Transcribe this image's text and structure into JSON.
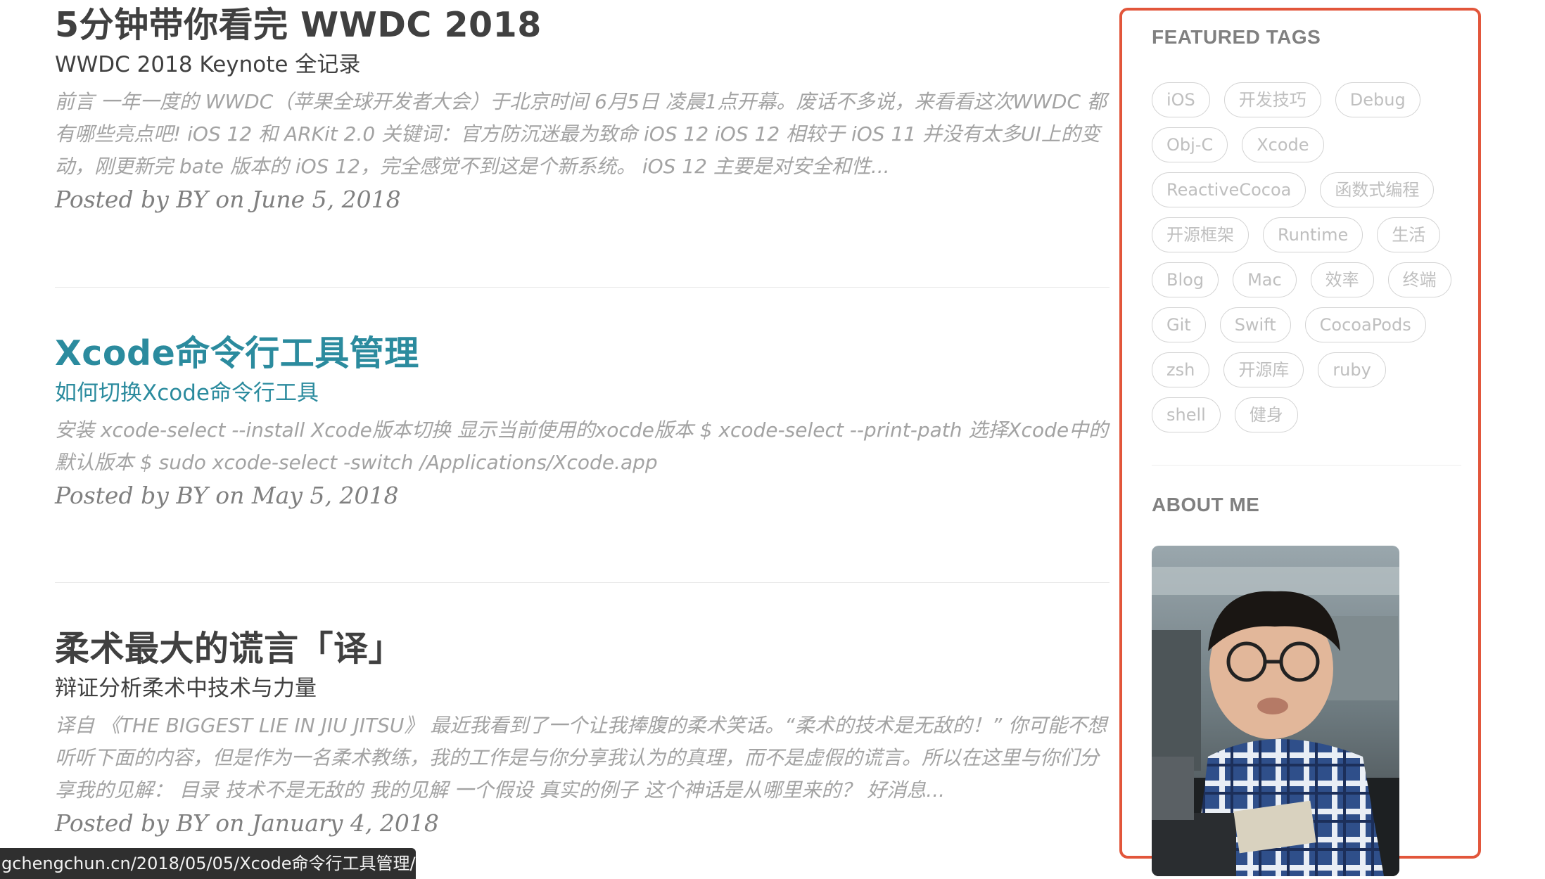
{
  "posts": [
    {
      "title": "5分钟带你看完 WWDC 2018",
      "subtitle": "WWDC 2018 Keynote 全记录",
      "excerpt": "前言 一年一度的 WWDC（苹果全球开发者大会）于北京时间 6月5日 凌晨1点开幕。废话不多说，来看看这次WWDC 都有哪些亮点吧! iOS 12 和 ARKit 2.0 关键词：官方防沉迷最为致命 iOS 12 iOS 12 相较于 iOS 11 并没有太多UI上的变动，刚更新完 bate 版本的 iOS 12，完全感觉不到这是个新系统。 iOS 12 主要是对安全和性...",
      "meta": "Posted by BY on June 5, 2018"
    },
    {
      "title": "Xcode命令行工具管理",
      "subtitle": "如何切换Xcode命令行工具",
      "excerpt": "安装 xcode-select --install Xcode版本切换 显示当前使用的xocde版本 $ xcode-select --print-path 选择Xcode中的默认版本 $ sudo xcode-select -switch /Applications/Xcode.app",
      "meta": "Posted by BY on May 5, 2018"
    },
    {
      "title": "柔术最大的谎言「译」",
      "subtitle": "辩证分析柔术中技术与力量",
      "excerpt": "译自 《THE BIGGEST LIE IN JIU JITSU》 最近我看到了一个让我捧腹的柔术笑话。“柔术的技术是无敌的！” 你可能不想听听下面的内容，但是作为一名柔术教练，我的工作是与你分享我认为的真理，而不是虚假的谎言。所以在这里与你们分享我的见解： 目录 技术不是无敌的 我的见解 一个假设 真实的例子 这个神话是从哪里来的？ 好消息...",
      "meta": "Posted by BY on January 4, 2018"
    }
  ],
  "sidebar": {
    "featured_tags_heading": "FEATURED TAGS",
    "tags": [
      "iOS",
      "开发技巧",
      "Debug",
      "Obj-C",
      "Xcode",
      "ReactiveCocoa",
      "函数式编程",
      "开源框架",
      "Runtime",
      "生活",
      "Blog",
      "Mac",
      "效率",
      "终端",
      "Git",
      "Swift",
      "CocoaPods",
      "zsh",
      "开源库",
      "ruby",
      "shell",
      "健身"
    ],
    "about_heading": "ABOUT ME"
  },
  "status_bar": {
    "url": "gchengchun.cn/2018/05/05/Xcode命令行工具管理/"
  },
  "colors": {
    "link_hover": "#2b8b9e",
    "sidebar_highlight": "#e2563b"
  }
}
